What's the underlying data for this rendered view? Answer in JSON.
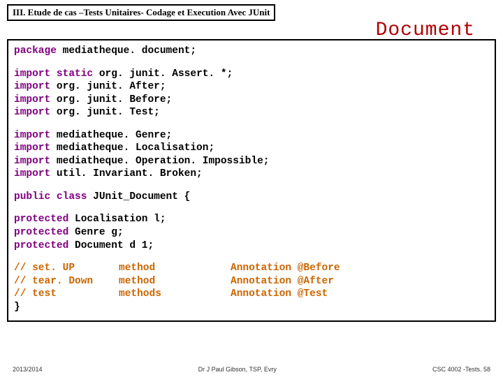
{
  "title": "III. Etude de cas –Tests Unitaires- Codage et Execution Avec JUnit",
  "doc_label": "Document",
  "code": {
    "pkg_kw": "package",
    "pkg": " mediatheque. document; ",
    "imp_kw": "import",
    "static_kw": "static",
    "i1": " org. junit. Assert. *; ",
    "i2": " org. junit. After; ",
    "i3": " org. junit. Before; ",
    "i4": " org. junit. Test; ",
    "i5": " mediatheque. Genre; ",
    "i6": " mediatheque. Localisation; ",
    "i7": " mediatheque. Operation. Impossible; ",
    "i8": " util. Invariant. Broken; ",
    "public_kw": "public",
    "class_kw": "class",
    "classname": " JUnit_Document { ",
    "protected_kw": "protected",
    "f1": " Localisation l; ",
    "f2": " Genre g; ",
    "f3": " Document d 1; ",
    "c1a": "// set. UP",
    "c1b": "method",
    "c1c": "Annotation @Before",
    "c2a": "// tear. Down",
    "c2b": "method",
    "c2c": "Annotation @After",
    "c3a": "// test",
    "c3b": "methods",
    "c3c": "Annotation @Test",
    "close": "}"
  },
  "footer": {
    "left": "2013/2014",
    "center": "Dr J Paul Gibson, TSP, Evry",
    "right": "CSC 4002 -Tests. 58"
  }
}
